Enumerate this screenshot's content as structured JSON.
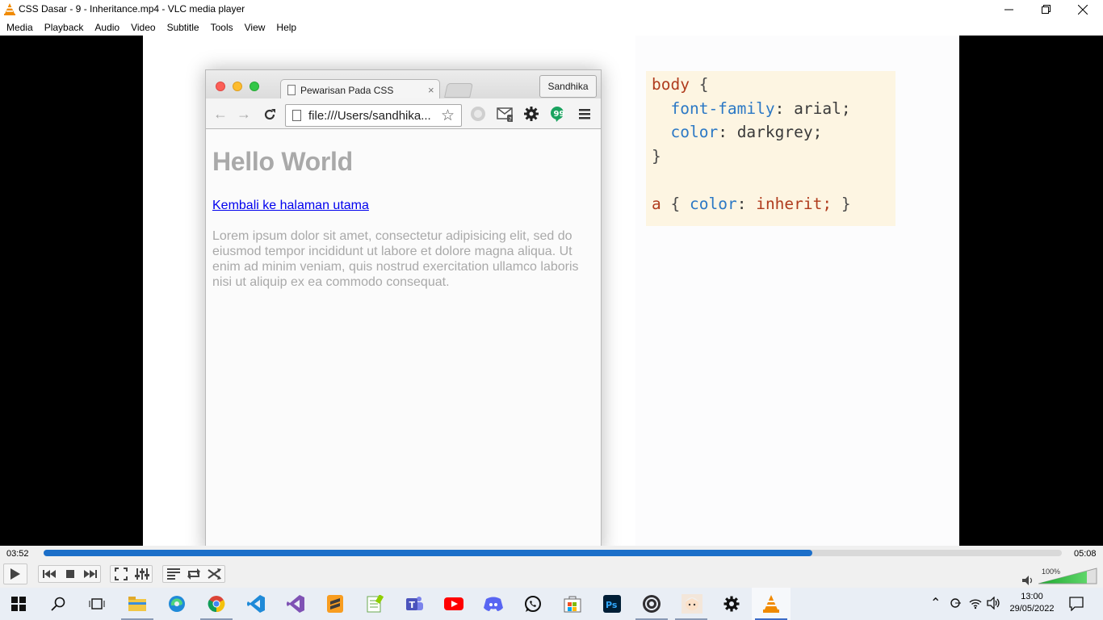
{
  "window": {
    "title": "CSS Dasar - 9 - Inheritance.mp4 - VLC media player",
    "minimize": "—",
    "restore": "❐",
    "close": "✕"
  },
  "menu": [
    {
      "label": "Media"
    },
    {
      "label": "Playback"
    },
    {
      "label": "Audio"
    },
    {
      "label": "Video"
    },
    {
      "label": "Subtitle"
    },
    {
      "label": "Tools"
    },
    {
      "label": "View"
    },
    {
      "label": "Help"
    }
  ],
  "video": {
    "browser": {
      "tab_title": "Pewarisan Pada CSS",
      "tab_close": "×",
      "profile_name": "Sandhika",
      "url": "file:///Users/sandhika...",
      "page": {
        "heading": "Hello World",
        "link": "Kembali ke halaman utama",
        "paragraph": "Lorem ipsum dolor sit amet, consectetur adipisicing elit, sed do eiusmod tempor incididunt ut labore et dolore magna aliqua. Ut enim ad minim veniam, quis nostrud exercitation ullamco laboris nisi ut aliquip ex ea commodo consequat."
      }
    },
    "code": {
      "selector_body": "body",
      "open": "{",
      "prop1": "font-family",
      "val1": "arial;",
      "prop2": "color",
      "val2": "darkgrey;",
      "close": "}",
      "selector_a": "a",
      "prop3": "color",
      "val3": "inherit;",
      "colon": ":"
    }
  },
  "player": {
    "elapsed": "03:52",
    "total": "05:08",
    "progress": 0.755,
    "volume_label": "100%",
    "volume": 1.0,
    "accent": "#1c6fc9"
  },
  "taskbar": {
    "time": "13:00",
    "date": "29/05/2022",
    "apps": [
      "start-icon",
      "search-icon",
      "task-view-icon",
      "file-explorer-icon",
      "edge-icon",
      "chrome-icon",
      "vscode-icon",
      "visual-studio-icon",
      "sublime-text-icon",
      "notepad-plus-plus-icon",
      "teams-icon",
      "youtube-icon",
      "discord-icon",
      "whatsapp-icon",
      "microsoft-store-icon",
      "photoshop-icon",
      "obs-icon",
      "anime-app-icon",
      "settings-icon",
      "vlc-icon"
    ]
  }
}
